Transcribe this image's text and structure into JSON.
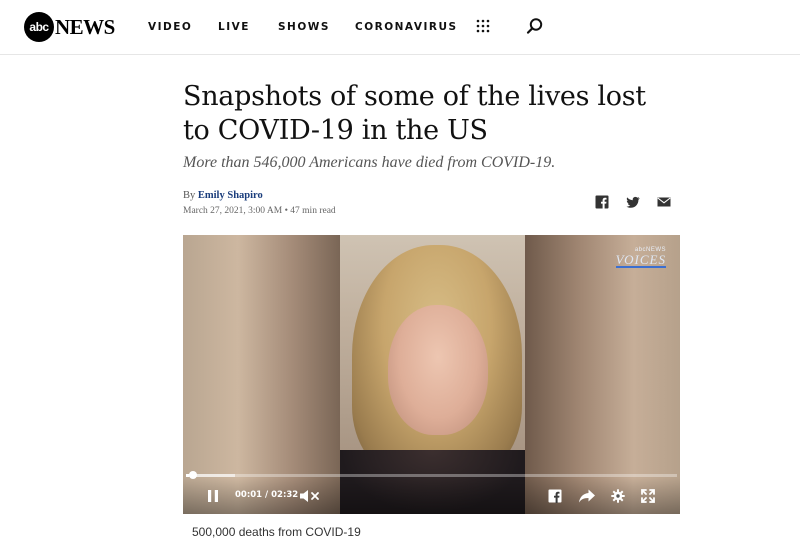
{
  "header": {
    "logo_mark": "abc",
    "logo_text": "NEWS",
    "nav": [
      "VIDEO",
      "LIVE",
      "SHOWS",
      "CORONAVIRUS"
    ]
  },
  "article": {
    "title": "Snapshots of some of the lives lost to COVID-19 in the US",
    "subtitle": "More than 546,000 Americans have died from COVID-19.",
    "byline_prefix": "By",
    "author": "Emily Shapiro",
    "date": "March 27, 2021, 3:00 AM",
    "read_time": "47 min read",
    "share_icons": [
      "facebook-icon",
      "twitter-icon",
      "email-icon"
    ]
  },
  "video": {
    "brand_small": "abcNEWS",
    "brand_big": "VOICES",
    "current_time": "00:01",
    "separator": "/",
    "duration": "02:32",
    "progress_fraction": 0.007,
    "buffered_fraction": 0.1,
    "state": "playing",
    "muted": true,
    "caption": "500,000 deaths from COVID-19"
  },
  "colors": {
    "author_link": "#1a3d7c",
    "voices_underline": "#3b6fd1"
  }
}
